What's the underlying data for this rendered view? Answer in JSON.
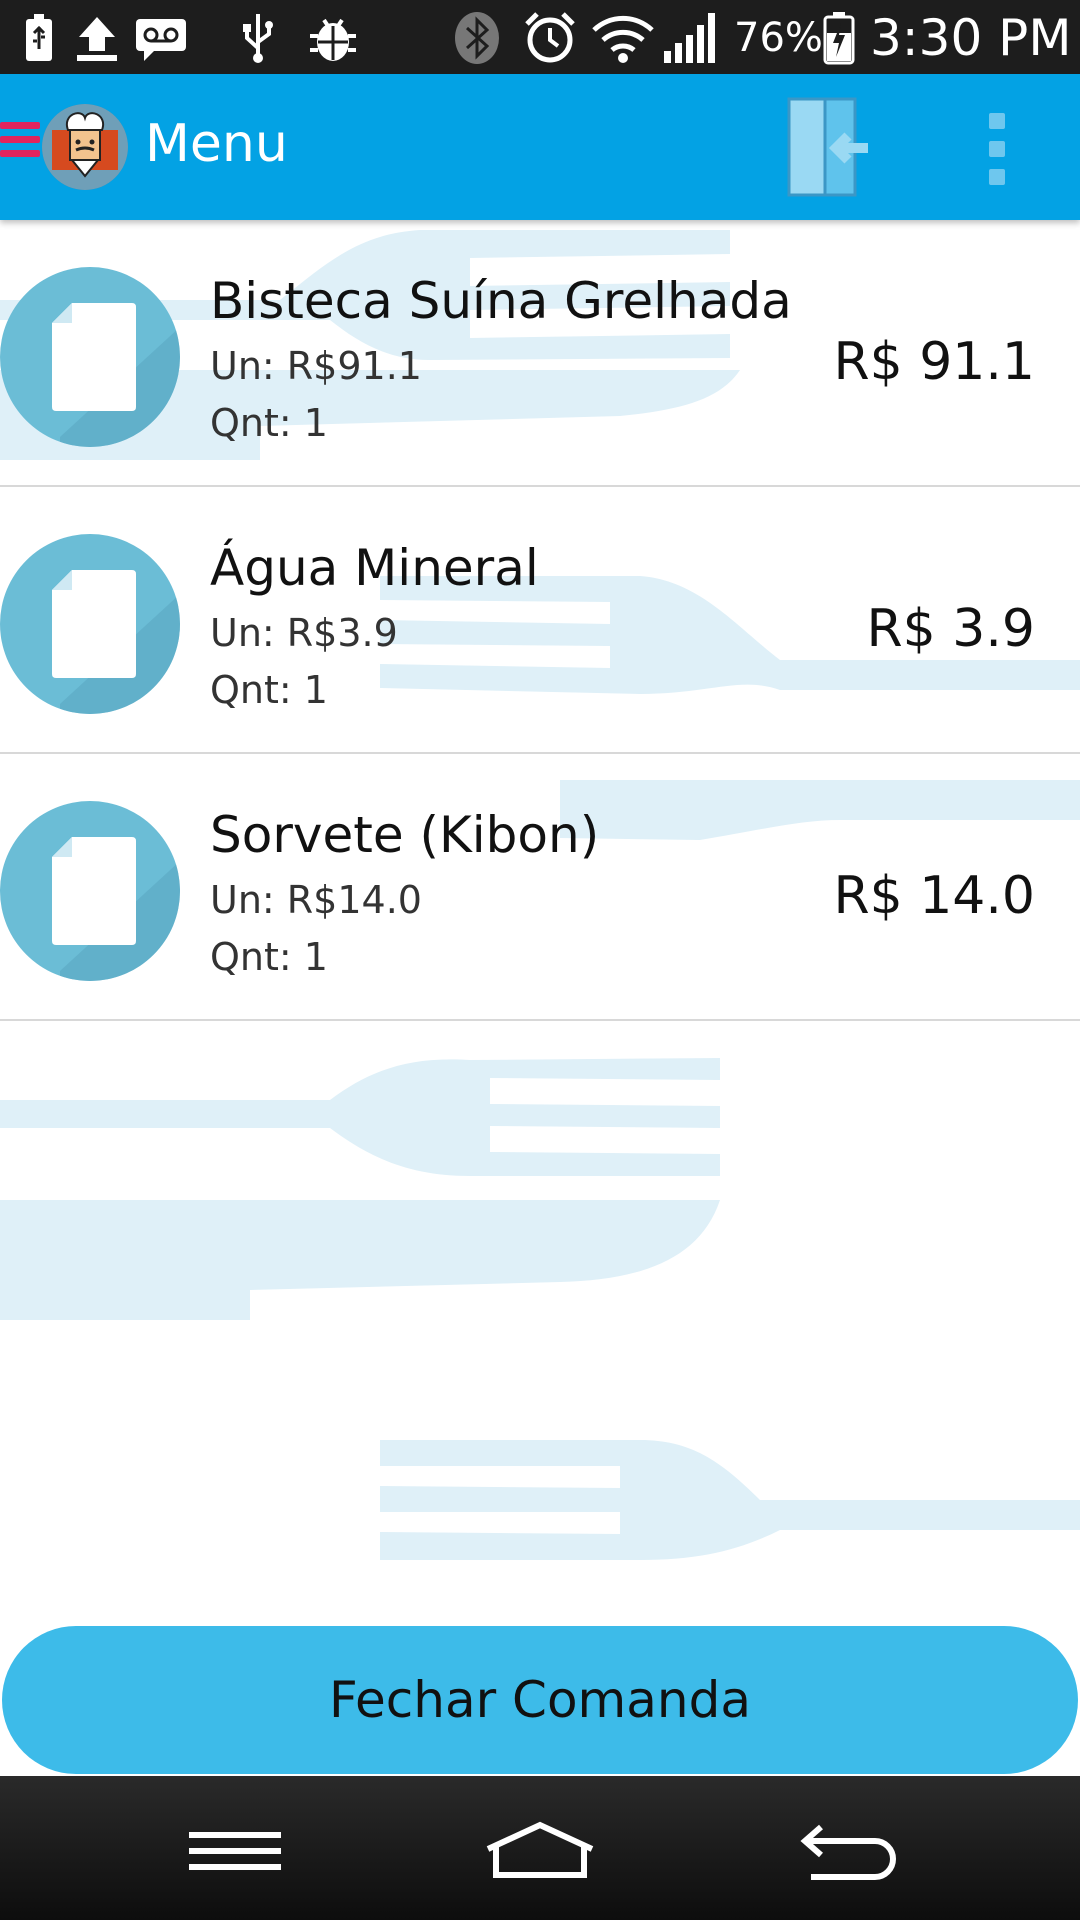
{
  "status_bar": {
    "battery_percent": "76%",
    "time": "3:30 PM",
    "icons": [
      "battery-usb-icon",
      "upload-icon",
      "voicemail-icon",
      "usb-icon",
      "bug-icon",
      "bluetooth-icon",
      "alarm-icon",
      "wifi-icon",
      "signal-icon",
      "battery-charging-icon"
    ]
  },
  "app_bar": {
    "title": "Menu",
    "icons": [
      "drawer-icon",
      "chef-logo",
      "logout-icon",
      "overflow-menu-icon"
    ],
    "accent_color": "#03a2e4"
  },
  "order": {
    "items": [
      {
        "name": "Bisteca Suína Grelhada",
        "unit": "Un: R$91.1",
        "qty": "Qnt: 1",
        "price": "R$ 91.1",
        "icon": "document-icon"
      },
      {
        "name": "Água Mineral",
        "unit": "Un: R$3.9",
        "qty": "Qnt: 1",
        "price": "R$ 3.9",
        "icon": "document-icon"
      },
      {
        "name": "Sorvete (Kibon)",
        "unit": "Un: R$14.0",
        "qty": "Qnt: 1",
        "price": "R$ 14.0",
        "icon": "document-icon"
      }
    ]
  },
  "actions": {
    "close_order_label": "Fechar Comanda",
    "button_color": "#3dbbe9"
  },
  "nav_bar": {
    "icons": [
      "menu-icon",
      "home-icon",
      "back-icon"
    ]
  }
}
